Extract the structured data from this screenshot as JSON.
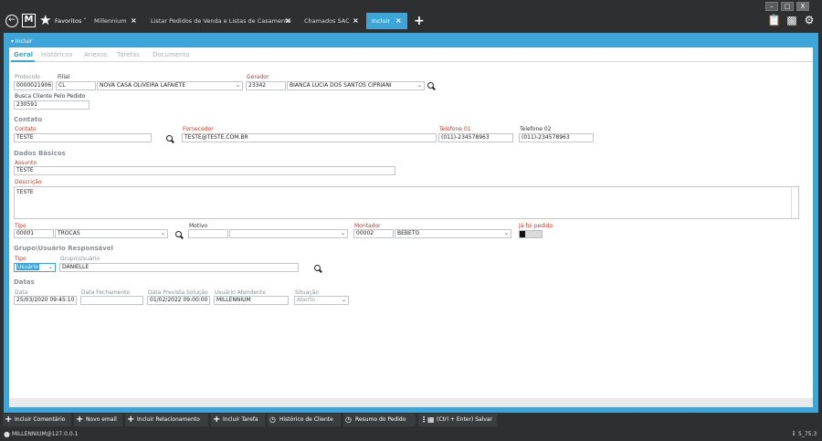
{
  "app": {
    "nav": {
      "back_icon": "back-arrow-icon",
      "logo": "M",
      "favorites": "Favoritos"
    },
    "window_controls": [
      "–",
      "□",
      "X"
    ],
    "tabs": [
      {
        "label": "Millennium"
      },
      {
        "label": "Listar Pedidos de Venda e Listas de Casamento"
      },
      {
        "label": "Chamados SAC"
      },
      {
        "label": "Incluir"
      }
    ],
    "close_glyph": "×",
    "add_tab": "+",
    "right_icons": [
      "clipboard-icon",
      "chat-icon",
      "gear-icon"
    ]
  },
  "form": {
    "title": "Incluir",
    "subtabs": [
      "Geral",
      "Históricos",
      "Anexos",
      "Tarefas",
      "Documento"
    ],
    "protocolo": {
      "label": "Protocolo",
      "value": "0000021906"
    },
    "filial": {
      "label": "Filial",
      "code": "CL",
      "name": "NOVA CASA OLIVEIRA LAFAIETE"
    },
    "gerador": {
      "label": "Gerador",
      "code": "23342",
      "name": "BIANCA LUCIA DOS SANTOS CIPRIANI"
    },
    "busca": {
      "label": "Busca Cliente Pelo Pedido",
      "value": "230591"
    },
    "contato_section": "Contato",
    "contato": {
      "label": "Contato",
      "value": "TESTE"
    },
    "fornecedor": {
      "label": "Fornecedor",
      "value": "TESTE@TESTE.COM.BR"
    },
    "telefone1": {
      "label": "Telefone 01",
      "value": "(011)-234578963"
    },
    "telefone2": {
      "label": "Telefone 02",
      "value": "(011)-234578963"
    },
    "dados_section": "Dados Básicos",
    "assunto": {
      "label": "Assunto",
      "value": "TESTE"
    },
    "descricao": {
      "label": "Descrição",
      "value": "TESTE"
    },
    "tipo": {
      "label": "Tipo",
      "code": "00001",
      "name": "TROCAS"
    },
    "motivo": {
      "label": "Motivo",
      "code": "",
      "name": ""
    },
    "montador": {
      "label": "Montador",
      "code": "00002",
      "name": "BEBETO"
    },
    "ja_foi": {
      "label": "Já foi pedido"
    },
    "grupo_section": "Grupo\\Usuário Responsável",
    "grupo_tipo": {
      "label": "Tipo",
      "value": "Usuário"
    },
    "grupo_usuario": {
      "label": "Grupo\\Usuário",
      "value": "DANIELLE"
    },
    "datas_section": "Datas",
    "data": {
      "label": "Data",
      "value": "25/03/2020 09:45:10"
    },
    "data_fechamento": {
      "label": "Data Fechamento",
      "value": ""
    },
    "data_prevista": {
      "label": "Data Prevista Solução",
      "value": "01/02/2022 09:00:00"
    },
    "usuario_atendente": {
      "label": "Usuário Atendente",
      "value": "MILLENNIUM"
    },
    "situacao": {
      "label": "Situação",
      "value": "Aberto"
    }
  },
  "actions": [
    {
      "label": "Incluir Comentário",
      "icon": "plus-icon"
    },
    {
      "label": "Novo email",
      "icon": "plus-icon"
    },
    {
      "label": "Incluir Relacionamento",
      "icon": "plus-icon"
    },
    {
      "label": "Incluir Tarefa",
      "icon": "plus-icon"
    },
    {
      "label": "Histórico de Cliente",
      "icon": "history-icon"
    },
    {
      "label": "Resumo do Pedido",
      "icon": "history-icon"
    },
    {
      "label": "(Ctrl + Enter) Salvar",
      "icon": "save-icon"
    }
  ],
  "status": {
    "user": "MILLENNIUM@127.0.0.1",
    "version": "5_75.3"
  }
}
